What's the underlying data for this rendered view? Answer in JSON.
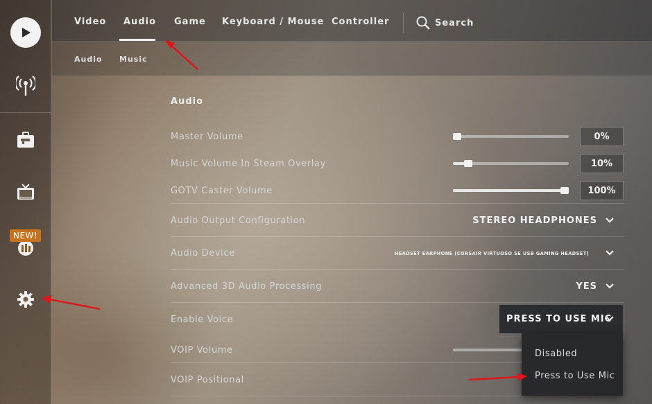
{
  "sidebar": {
    "items": [
      {
        "icon": "play-icon"
      },
      {
        "icon": "broadcast-icon"
      },
      {
        "icon": "inventory-briefcase-icon"
      },
      {
        "icon": "tv-icon"
      },
      {
        "icon": "store-icon"
      },
      {
        "icon": "gear-icon"
      }
    ],
    "new_badge": "NEW!"
  },
  "nav": {
    "tabs": [
      "Video",
      "Audio",
      "Game",
      "Keyboard / Mouse",
      "Controller"
    ],
    "active_tab": "Audio",
    "search_label": "Search"
  },
  "subnav": {
    "tabs": [
      "Audio",
      "Music"
    ]
  },
  "settings": {
    "section_title": "Audio",
    "master_volume": {
      "label": "Master Volume",
      "value": "0%",
      "level": 0.0
    },
    "music_volume_overlay": {
      "label": "Music Volume In Steam Overlay",
      "value": "10%",
      "level": 0.1
    },
    "gotv_caster_volume": {
      "label": "GOTV Caster Volume",
      "value": "100%",
      "level": 1.0
    },
    "audio_output_config": {
      "label": "Audio Output Configuration",
      "value": "STEREO HEADPHONES"
    },
    "audio_device": {
      "label": "Audio Device",
      "value": "HEADSET EARPHONE (CORSAIR VIRTUOSO SE USB GAMING HEADSET)"
    },
    "advanced_3d": {
      "label": "Advanced 3D Audio Processing",
      "value": "YES"
    },
    "enable_voice": {
      "label": "Enable Voice",
      "value": "PRESS TO USE MIC"
    },
    "voip_volume": {
      "label": "VOIP Volume"
    },
    "voip_positional": {
      "label": "VOIP Positional"
    }
  },
  "voice_dropdown": {
    "options": [
      "Disabled",
      "Press to Use Mic"
    ]
  },
  "colors": {
    "badge": "#c7731d",
    "annotation_arrow": "#e0141a"
  }
}
